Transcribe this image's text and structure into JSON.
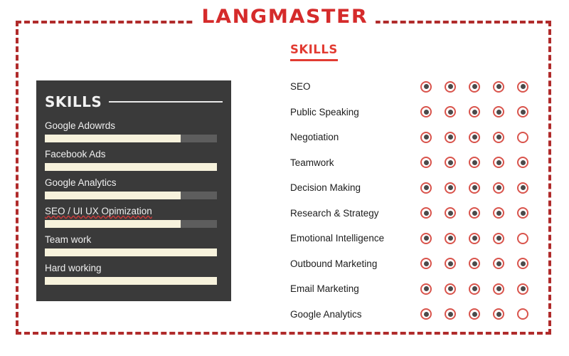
{
  "brand": {
    "name": "LANGMASTER"
  },
  "colors": {
    "accent_red": "#e23b32",
    "border_red": "#b02b2b",
    "panel_bg": "#3a3a3a",
    "bar_fill": "#f7f2dc",
    "bar_track": "#5d5d5d",
    "dot_center": "#4a4a4a"
  },
  "panel": {
    "title": "SKILLS",
    "bars": [
      {
        "label": "Google Adowrds",
        "percent": 79,
        "misspelled": false
      },
      {
        "label": "Facebook Ads",
        "percent": 100,
        "misspelled": false
      },
      {
        "label": "Google Analytics",
        "percent": 79,
        "misspelled": false
      },
      {
        "label": "SEO / UI UX Opimization",
        "percent": 79,
        "misspelled": true
      },
      {
        "label": "Team work",
        "percent": 100,
        "misspelled": false
      },
      {
        "label": "Hard working",
        "percent": 100,
        "misspelled": false
      }
    ]
  },
  "ratings": {
    "title": "SKILLS",
    "max": 5,
    "rows": [
      {
        "label": "SEO",
        "value": 5
      },
      {
        "label": "Public Speaking",
        "value": 5
      },
      {
        "label": "Negotiation",
        "value": 4
      },
      {
        "label": "Teamwork",
        "value": 5
      },
      {
        "label": "Decision Making",
        "value": 5
      },
      {
        "label": "Research & Strategy",
        "value": 5
      },
      {
        "label": "Emotional Intelligence",
        "value": 4
      },
      {
        "label": "Outbound Marketing",
        "value": 5
      },
      {
        "label": "Email Marketing",
        "value": 5
      },
      {
        "label": "Google Analytics",
        "value": 4
      }
    ]
  },
  "chart_data": [
    {
      "type": "bar",
      "title": "SKILLS",
      "orientation": "horizontal",
      "categories": [
        "Google Adowrds",
        "Facebook Ads",
        "Google Analytics",
        "SEO / UI UX Opimization",
        "Team work",
        "Hard working"
      ],
      "values": [
        79,
        100,
        79,
        79,
        100,
        100
      ],
      "xlabel": "",
      "ylabel": "",
      "xlim": [
        0,
        100
      ],
      "grid": false,
      "legend": null
    },
    {
      "type": "bar",
      "title": "SKILLS",
      "subtype": "rating-dots",
      "categories": [
        "SEO",
        "Public Speaking",
        "Negotiation",
        "Teamwork",
        "Decision Making",
        "Research & Strategy",
        "Emotional Intelligence",
        "Outbound Marketing",
        "Email Marketing",
        "Google Analytics"
      ],
      "values": [
        5,
        5,
        4,
        5,
        5,
        5,
        4,
        5,
        5,
        4
      ],
      "xlabel": "",
      "ylabel": "",
      "xlim": [
        0,
        5
      ],
      "grid": false,
      "legend": null
    }
  ]
}
